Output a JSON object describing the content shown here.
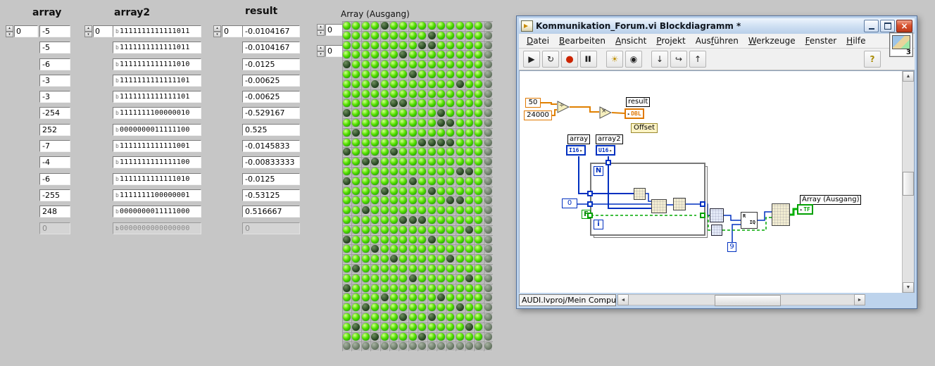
{
  "icons": {
    "up_arrow": "▴",
    "down_arrow": "▾",
    "left_arrow": "◄",
    "right_arrow": "►",
    "scroll_up": "▲",
    "scroll_down": "▼",
    "run": "▶",
    "run_continuous": "↻",
    "abort": "●",
    "pause": "▌▌",
    "highlight_execution": "☀",
    "retain_values": "◉",
    "step_into": "↓",
    "step_over": "↪",
    "step_out": "↑",
    "help": "?",
    "close": "×",
    "divide": "÷",
    "multiply": "×",
    "terminal_arrow": "▸"
  },
  "colors": {
    "wire_orange": "#e08000",
    "wire_blue": "#0030c0",
    "wire_green": "#00a800",
    "led_on": "#44dd00",
    "led_off": "#2e4f28"
  },
  "panel": {
    "array": {
      "label": "array",
      "index": "0",
      "values": [
        "-5",
        "-5",
        "-6",
        "-3",
        "-3",
        "-254",
        "252",
        "-7",
        "-4",
        "-6",
        "-255",
        "248"
      ],
      "disabled_value": "0"
    },
    "array2": {
      "label": "array2",
      "index": "0",
      "radix": "b",
      "values": [
        "1111111111111011",
        "1111111111111011",
        "1111111111111010",
        "1111111111111101",
        "1111111111111101",
        "1111111100000010",
        "0000000011111100",
        "1111111111111001",
        "1111111111111100",
        "1111111111111010",
        "1111111100000001",
        "0000000011111000"
      ],
      "disabled_value": "0000000000000000"
    },
    "result": {
      "label": "result",
      "index": "0",
      "values": [
        "-0.0104167",
        "-0.0104167",
        "-0.0125",
        "-0.00625",
        "-0.00625",
        "-0.529167",
        "0.525",
        "-0.0145833",
        "-0.00833333",
        "-0.0125",
        "-0.53125",
        "0.516667"
      ],
      "disabled_value": "0"
    },
    "led_array": {
      "label": "Array (Ausgang)",
      "row_index": "0",
      "col_index": "0",
      "rows": [
        "111101111111111x",
        "111111111011111x",
        "111111110011111x",
        "111111011111111x",
        "011111111111111x",
        "111111101111111x",
        "111011111111011x",
        "111111111111111x",
        "111110011111111x",
        "011111111101111x",
        "111111111100111x",
        "101111111111111x",
        "111111110000111x",
        "011110111111111x",
        "110011111111111x",
        "111111111111001x",
        "011111101111111x",
        "111101111011111x",
        "111111111110011x",
        "110111111111111x",
        "111111000111111x",
        "111111111111101x",
        "011111111011111x",
        "111011111111111x",
        "111110111110111x",
        "101111111111111x",
        "111111101111101x",
        "011111111111111x",
        "111101111101111x",
        "110111111111011x",
        "111111011011111x",
        "101111111111101x",
        "111011110111111x",
        "xxxxxxxxxxxxxxxx"
      ]
    }
  },
  "window": {
    "title": "Kommunikation_Forum.vi Blockdiagramm *",
    "vi_badge": "3",
    "statusbar": "AUDI.lvproj/Mein Computer",
    "menu": [
      {
        "label": "Datei",
        "u": 0
      },
      {
        "label": "Bearbeiten",
        "u": 0
      },
      {
        "label": "Ansicht",
        "u": 0
      },
      {
        "label": "Projekt",
        "u": 0
      },
      {
        "label": "Ausführen",
        "u": 3
      },
      {
        "label": "Werkzeuge",
        "u": 0
      },
      {
        "label": "Fenster",
        "u": 0
      },
      {
        "label": "Hilfe",
        "u": 0
      }
    ],
    "toolbar": [
      {
        "name": "run",
        "icon": "run"
      },
      {
        "name": "run-continuous",
        "icon": "run_continuous"
      },
      {
        "name": "abort",
        "icon": "abort"
      },
      {
        "name": "pause",
        "icon": "pause"
      },
      {
        "sep": true
      },
      {
        "name": "highlight-execution",
        "icon": "highlight_execution"
      },
      {
        "name": "retain-wire-values",
        "icon": "retain_values"
      },
      {
        "sep": true
      },
      {
        "name": "step-into",
        "icon": "step_into"
      },
      {
        "name": "step-over",
        "icon": "step_over"
      },
      {
        "name": "step-out",
        "icon": "step_out"
      }
    ],
    "diagram": {
      "const50": "50",
      "const24000": "24000",
      "result_label": "result",
      "result_type": "DBL",
      "offset_label": "Offset",
      "array_label": "array",
      "array_type": "I16",
      "array2_label": "array2",
      "array2_type": "U16",
      "loop_count": "N",
      "loop_index": "i",
      "const0": "0",
      "bool_false": "F",
      "const9": "9",
      "riq_top": "R",
      "riq_bottom": "IQ",
      "output_label": "Array (Ausgang)",
      "output_type": "TF"
    }
  }
}
